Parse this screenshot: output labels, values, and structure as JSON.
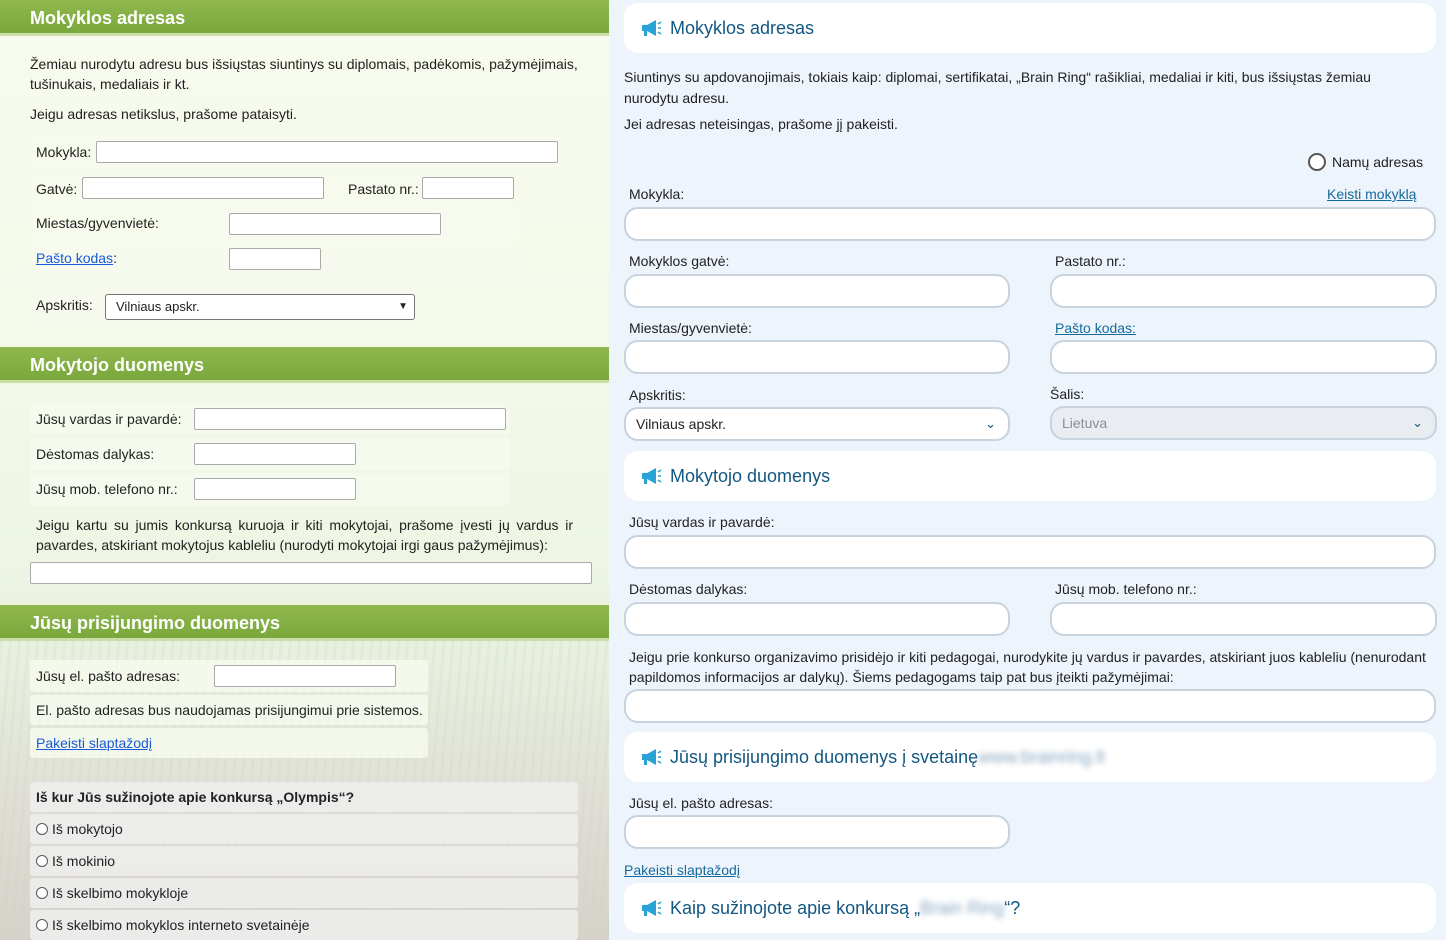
{
  "left": {
    "school_address": {
      "heading": "Mokyklos adresas",
      "intro": "Žemiau nurodytu adresu bus išsiųstas siuntinys su diplomais, padėkomis, pažymėjimais, tušinukais, medaliais ir kt.",
      "note": "Jeigu adresas netikslus, prašome pataisyti.",
      "school_label": "Mokykla:",
      "school_value": "",
      "street_label": "Gatvė:",
      "street_value": "",
      "building_label": "Pastato nr.:",
      "building_value": "",
      "city_label": "Miestas/gyvenvietė:",
      "city_value": "",
      "postcode_link": "Pašto kodas",
      "postcode_colon": ":",
      "postcode_value": "",
      "county_label": "Apskritis:",
      "county_value": "Vilniaus apskr."
    },
    "teacher": {
      "heading": "Mokytojo duomenys",
      "name_label": "Jūsų vardas ir pavardė:",
      "subject_label": "Dėstomas dalykas:",
      "phone_label": "Jūsų mob. telefono nr.:",
      "others_note": "Jeigu kartu su jumis konkursą kuruoja ir kiti mokytojai, prašome įvesti jų vardus ir pavardes, atskiriant mokytojus kableliu (nurodyti mokytojai irgi gaus pažymėjimus):"
    },
    "login": {
      "heading": "Jūsų prisijungimo duomenys",
      "email_label": "Jūsų el. pašto adresas:",
      "email_note": "El. pašto adresas bus naudojamas prisijungimui prie sistemos.",
      "change_password": "Pakeisti slaptažodį"
    },
    "survey": {
      "question": "Iš kur Jūs sužinojote apie konkursą „Olympis“?",
      "options": [
        "Iš mokytojo",
        "Iš mokinio",
        "Iš skelbimo mokykloje",
        "Iš skelbimo mokyklos interneto svetainėje"
      ]
    }
  },
  "right": {
    "school_address": {
      "heading": "Mokyklos adresas",
      "intro": "Siuntinys su apdovanojimais, tokiais kaip: diplomai, sertifikatai, „Brain Ring“ rašikliai, medaliai ir kiti, bus išsiųstas žemiau nurodytu adresu.",
      "note": "Jei adresas neteisingas, prašome jį pakeisti.",
      "home_address_radio": "Namų adresas",
      "school_label": "Mokykla:",
      "change_school": "Keisti mokyklą",
      "street_label": "Mokyklos gatvė:",
      "building_label": "Pastato nr.:",
      "city_label": "Miestas/gyvenvietė:",
      "postcode_link": "Pašto kodas:",
      "county_label": "Apskritis:",
      "county_value": "Vilniaus apskr.",
      "country_label": "Šalis:",
      "country_value": "Lietuva"
    },
    "teacher": {
      "heading": "Mokytojo duomenys",
      "name_label": "Jūsų vardas ir pavardė:",
      "subject_label": "Dėstomas dalykas:",
      "phone_label": "Jūsų mob. telefono nr.:",
      "others_note": "Jeigu prie konkurso organizavimo prisidėjo ir kiti pedagogai, nurodykite jų vardus ir pavardes, atskiriant juos kableliu (nenurodant papildomos informacijos ar dalykų). Šiems pedagogams taip pat bus įteikti pažymėjimai:"
    },
    "login": {
      "heading_prefix": "Jūsų prisijungimo duomenys į svetainę",
      "heading_blurred": "www.brainring.lt",
      "email_label": "Jūsų el. pašto adresas:",
      "change_password": "Pakeisti slaptažodį"
    },
    "survey": {
      "heading_prefix": "Kaip sužinojote apie konkursą „",
      "heading_blurred": "Brain Ring",
      "heading_suffix": "“?"
    }
  },
  "colors": {
    "left_header_green": "#7aa83c",
    "right_accent_blue": "#125782",
    "right_background": "#eef4fb"
  }
}
